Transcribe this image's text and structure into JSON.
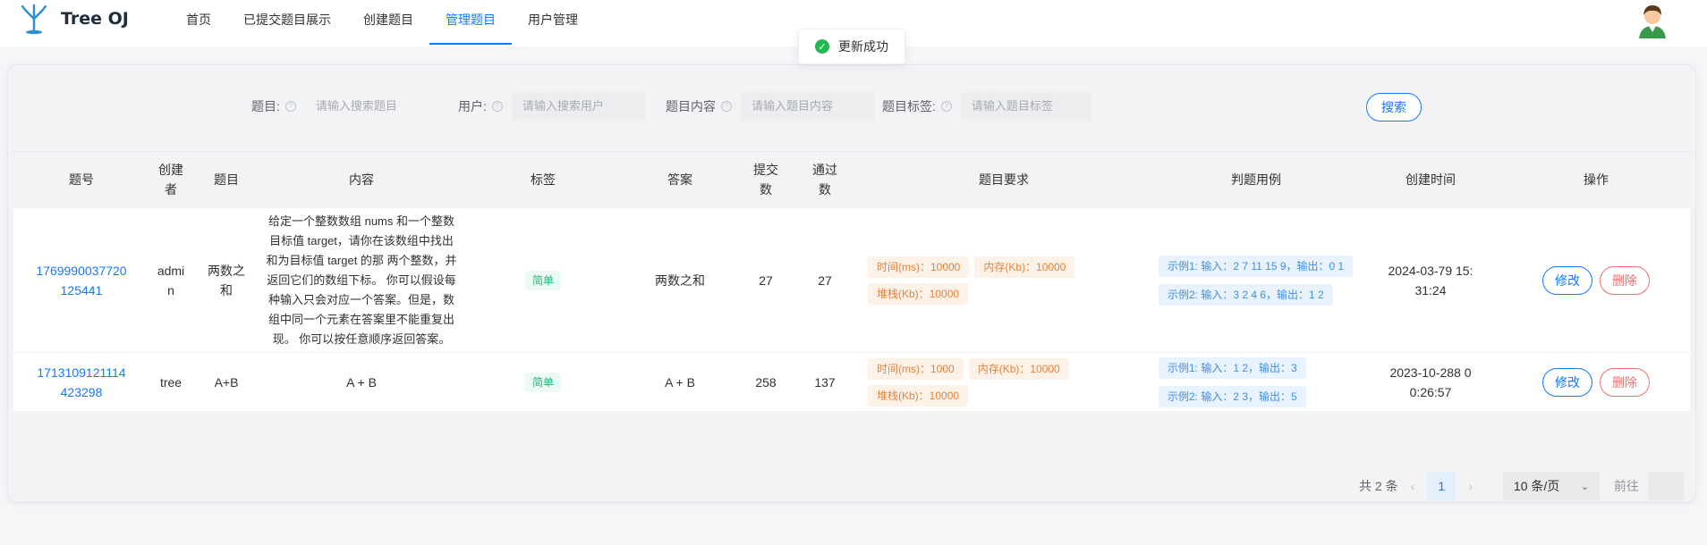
{
  "app": {
    "name": "Tree OJ"
  },
  "nav": [
    {
      "label": "首页",
      "active": false
    },
    {
      "label": "已提交题目展示",
      "active": false
    },
    {
      "label": "创建题目",
      "active": false
    },
    {
      "label": "管理题目",
      "active": true
    },
    {
      "label": "用户管理",
      "active": false
    }
  ],
  "toast": {
    "text": "更新成功",
    "icon": "check-circle-icon",
    "color": "#22b84f"
  },
  "search": {
    "title_label": "题目:",
    "title_placeholder": "请输入搜索题目",
    "user_label": "用户:",
    "user_placeholder": "请输入搜索用户",
    "content_label": "题目内容",
    "content_placeholder": "请输入题目内容",
    "tags_label": "题目标签:",
    "tags_placeholder": "请输入题目标签",
    "button": "搜索"
  },
  "table": {
    "headers": {
      "id": "题号",
      "creator_1": "创建",
      "creator_2": "者",
      "title": "题目",
      "content": "内容",
      "tags": "标签",
      "answer": "答案",
      "submit_1": "提交",
      "submit_2": "数",
      "accept_1": "通过",
      "accept_2": "数",
      "config": "题目要求",
      "cases": "判题用例",
      "created": "创建时间",
      "ops": "操作"
    },
    "rows": [
      {
        "id_1": "1769990037720",
        "id_2": "125441",
        "creator_1": "admi",
        "creator_2": "n",
        "title_1": "两数之",
        "title_2": "和",
        "content": "给定一个整数数组 nums 和一个整数目标值 target，请你在该数组中找出 和为目标值 target 的那 两个整数，并返回它们的数组下标。 你可以假设每种输入只会对应一个答案。但是，数组中同一个元素在答案里不能重复出现。 你可以按任意顺序返回答案。",
        "tag": "简单",
        "answer": "两数之和",
        "submit": "27",
        "accept": "27",
        "time": "时间(ms)：10000",
        "memory": "内存(Kb)：10000",
        "stack": "堆栈(Kb)：10000",
        "case_1": "示例1: 输入：2 7 11 15 9，输出：0 1",
        "case_2": "示例2: 输入：3 2 4 6，输出：1 2",
        "created_1": "2024-03-79 15:",
        "created_2": "31:24",
        "edit": "修改",
        "delete": "删除"
      },
      {
        "id_1": "1713109121114",
        "id_2": "423298",
        "creator_1": "tree",
        "creator_2": "",
        "title_1": "A+B",
        "title_2": "",
        "content": "A + B",
        "tag": "简单",
        "answer": "A + B",
        "submit": "258",
        "accept": "137",
        "time": "时间(ms)：1000",
        "memory": "内存(Kb)：10000",
        "stack": "堆栈(Kb)：10000",
        "case_1": "示例1: 输入：1 2，输出：3",
        "case_2": "示例2: 输入：2 3，输出：5",
        "created_1": "2023-10-288 0",
        "created_2": "0:26:57",
        "edit": "修改",
        "delete": "删除"
      }
    ]
  },
  "pagination": {
    "total": "共 2 条",
    "page": "1",
    "page_size": "10 条/页",
    "jump_label": "前往"
  },
  "colors": {
    "primary": "#1677ff",
    "danger": "#f56c6c",
    "success": "#2bb673",
    "warning": "#e6813a"
  }
}
